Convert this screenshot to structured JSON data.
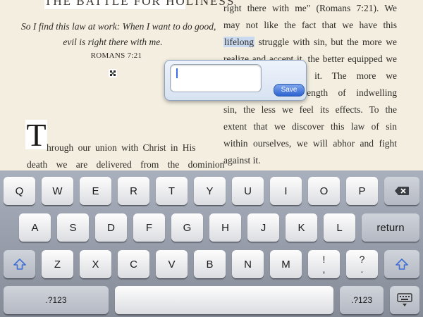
{
  "reader": {
    "chapter_title": "THE BATTLE FOR HOLINESS",
    "epigraph_line1": "So I find this law at work: When I want to do good,",
    "epigraph_line2": "evil is right there with me.",
    "citation": "ROMANS 7:21",
    "drop_cap": "T",
    "left_body": [
      "hrough our union with Christ in His",
      "death we are delivered from the dominion"
    ],
    "right_body": [
      {
        "before": "right there with me\" (Romans 7:21). We",
        "highlight": "",
        "after": ""
      },
      {
        "before": "may not like the fact that we have this",
        "highlight": "",
        "after": ""
      },
      {
        "before": "",
        "highlight": "lifelong",
        "after": " struggle with sin, but the more we"
      },
      {
        "before": "realize and accept it, the better equipped we",
        "highlight": "",
        "after": ""
      },
      {
        "before": "are to deal with it. The more we",
        "highlight": "",
        "after": ""
      },
      {
        "before": "understand the strength of indwelling",
        "highlight": "",
        "after": ""
      },
      {
        "before": "sin, the less we feel its effects. To the",
        "highlight": "",
        "after": ""
      },
      {
        "before": "extent that we discover this law of sin",
        "highlight": "",
        "after": ""
      },
      {
        "before": "within ourselves, we will abhor and fight",
        "highlight": "",
        "after": ""
      },
      {
        "before": "against it.",
        "highlight": "",
        "after": ""
      }
    ]
  },
  "note": {
    "value": "",
    "save_label": "Save"
  },
  "keyboard": {
    "row1": [
      "Q",
      "W",
      "E",
      "R",
      "T",
      "Y",
      "U",
      "I",
      "O",
      "P"
    ],
    "row2": [
      "A",
      "S",
      "D",
      "F",
      "G",
      "H",
      "J",
      "K",
      "L"
    ],
    "row3": [
      "Z",
      "X",
      "C",
      "V",
      "B",
      "N",
      "M"
    ],
    "return_label": "return",
    "numbers_label": ".?123",
    "punct_exclaim": [
      "!",
      ","
    ],
    "punct_question": [
      "?",
      "."
    ],
    "icons": {
      "backspace": "backspace-icon",
      "shift": "shift-icon",
      "hide_keyboard": "keyboard-hide-icon"
    },
    "colors": {
      "shift_arrow": "#3f6fd6",
      "highlight": "#c9d9ef",
      "save_button": "#2f63cf"
    }
  }
}
